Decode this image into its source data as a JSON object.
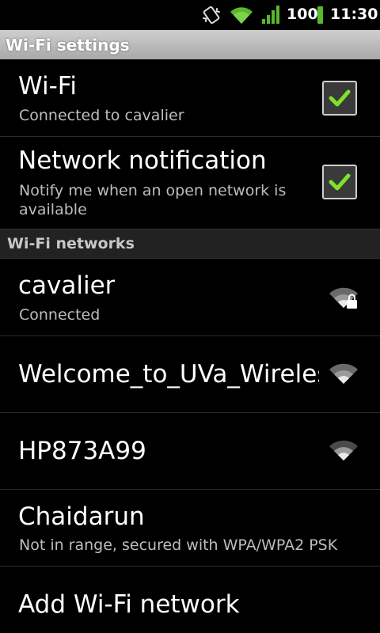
{
  "status_bar": {
    "battery_text": "100",
    "time": "11:30",
    "icons": [
      "vibrate-icon",
      "wifi-icon",
      "signal-icon",
      "battery-icon"
    ],
    "battery_color": "#5ab82e",
    "signal_color": "#5ab82e"
  },
  "header": {
    "title": "Wi-Fi settings"
  },
  "wifi_toggle": {
    "title": "Wi-Fi",
    "summary": "Connected to cavalier",
    "checked": true
  },
  "network_notification": {
    "title": "Network notification",
    "summary": "Notify me when an open network is available",
    "checked": true
  },
  "networks_header": {
    "title": "Wi-Fi networks"
  },
  "networks": [
    {
      "name": "cavalier",
      "status": "Connected",
      "icon": "wifi-lock-icon"
    },
    {
      "name": "Welcome_to_UVa_Wireless",
      "status": "",
      "icon": "wifi-icon"
    },
    {
      "name": "HP873A99",
      "status": "",
      "icon": "wifi-icon"
    },
    {
      "name": "Chaidarun",
      "status": "Not in range, secured with WPA/WPA2 PSK",
      "icon": ""
    }
  ],
  "add_network": {
    "label": "Add Wi-Fi network"
  },
  "colors": {
    "check": "#7fe22a",
    "background": "#000000",
    "header_gradient": "#b8b8b8"
  }
}
